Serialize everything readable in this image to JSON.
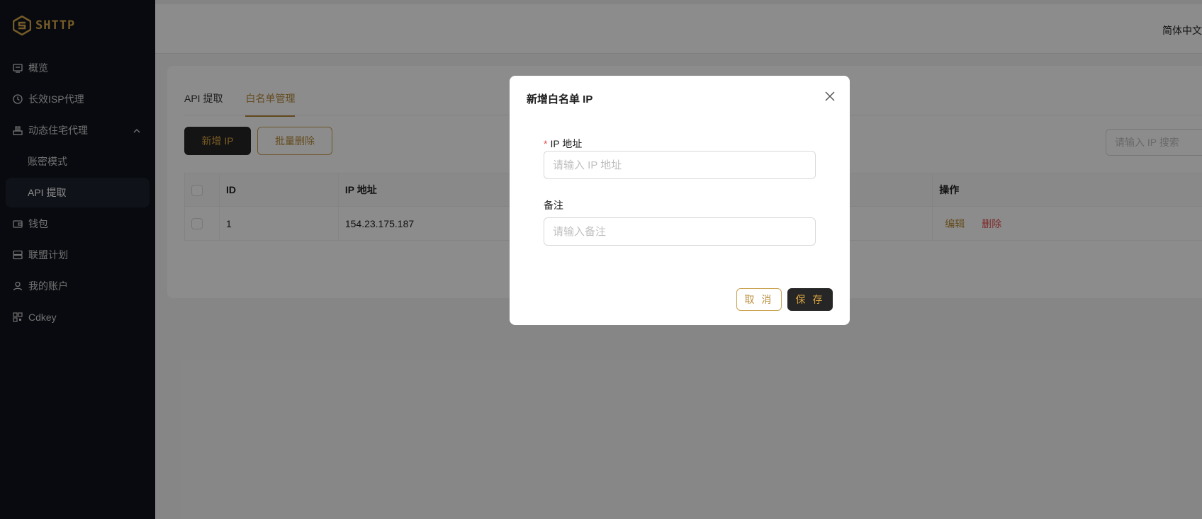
{
  "app": {
    "logo_text": "SHTTP"
  },
  "sidebar": {
    "items": [
      {
        "label": "概览",
        "icon": "dashboard-icon"
      },
      {
        "label": "长效ISP代理",
        "icon": "clock-icon"
      },
      {
        "label": "动态住宅代理",
        "icon": "house-icon",
        "expanded": true
      },
      {
        "label": "账密模式",
        "sub": true
      },
      {
        "label": "API 提取",
        "sub": true,
        "active": true
      },
      {
        "label": "钱包",
        "icon": "wallet-icon"
      },
      {
        "label": "联盟计划",
        "icon": "server-icon"
      },
      {
        "label": "我的账户",
        "icon": "user-icon"
      },
      {
        "label": "Cdkey",
        "icon": "key-icon"
      }
    ]
  },
  "header": {
    "language": "简体中文"
  },
  "tabs": [
    {
      "label": "API 提取",
      "active": false
    },
    {
      "label": "白名单管理",
      "active": true
    }
  ],
  "toolbar": {
    "add_label": "新增 IP",
    "batch_delete_label": "批量删除",
    "search_placeholder": "请输入 IP 搜索"
  },
  "table": {
    "columns": [
      "ID",
      "IP 地址",
      "操作"
    ],
    "rows": [
      {
        "id": "1",
        "ip": "154.23.175.187",
        "edit_label": "编辑",
        "delete_label": "删除"
      }
    ]
  },
  "modal": {
    "title": "新增白名单 IP",
    "ip_label": "IP 地址",
    "ip_required_mark": "*",
    "ip_placeholder": "请输入 IP 地址",
    "note_label": "备注",
    "note_placeholder": "请输入备注",
    "cancel_label": "取 消",
    "save_label": "保 存"
  },
  "colors": {
    "accent": "#b98d3a",
    "dark": "#262626",
    "sidebar_bg": "#0f131c",
    "danger": "#e34d4d"
  }
}
